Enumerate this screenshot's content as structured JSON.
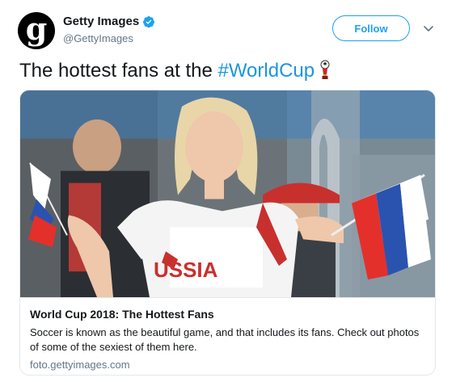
{
  "account": {
    "display_name": "Getty Images",
    "handle": "@GettyImages",
    "avatar_letter": "g",
    "verified_icon": "verified-badge-icon"
  },
  "actions": {
    "follow_label": "Follow",
    "more_icon": "chevron-down-icon"
  },
  "tweet": {
    "text": "The hottest fans at the ",
    "hashtag": "#WorldCup",
    "emoji": "world-cup-trophy-icon"
  },
  "card": {
    "image_alt_icon": "photo",
    "jersey_text": "USSIA",
    "title": "World Cup 2018: The Hottest Fans",
    "description": "Soccer is known as the beautiful game, and that includes its fans. Check out photos of some of the sexiest of them here.",
    "domain": "foto.gettyimages.com"
  },
  "colors": {
    "link_blue": "#1b95e0",
    "follow_blue": "#1da1f2",
    "secondary_text": "#657786",
    "border": "#e1e8ed",
    "flag_white": "#ffffff",
    "flag_blue": "#2a53b0",
    "flag_red": "#e4302a"
  }
}
